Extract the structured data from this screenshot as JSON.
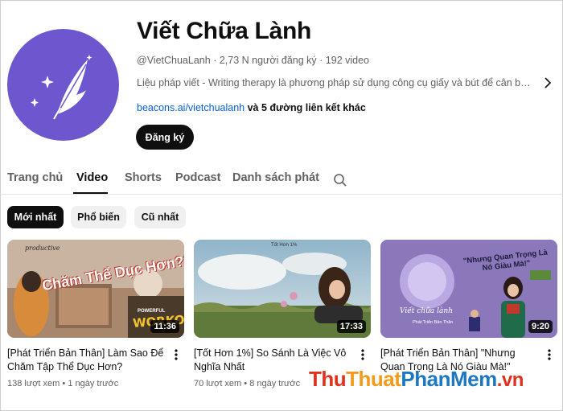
{
  "channel": {
    "title": "Viết Chữa Lành",
    "handle": "@VietChuaLanh",
    "subscribers": "2,73 N người đăng ký",
    "video_count": "192 video",
    "separator": "·",
    "description": "Liệu pháp viết - Writing therapy là phương pháp sử dụng công cụ giấy và bút để cân bằng c...",
    "link_url_text": "beacons.ai/vietchualanh",
    "link_extra": "và 5 đường liên kết khác",
    "subscribe_label": "Đăng ký",
    "avatar_color": "#6e56cf"
  },
  "tabs": [
    {
      "label": "Trang chủ"
    },
    {
      "label": "Video"
    },
    {
      "label": "Shorts"
    },
    {
      "label": "Podcast"
    },
    {
      "label": "Danh sách phát"
    }
  ],
  "chips": [
    {
      "label": "Mới nhất"
    },
    {
      "label": "Phổ biến"
    },
    {
      "label": "Cũ nhất"
    }
  ],
  "videos": [
    {
      "title": "[Phát Triển Bản Thân] Làm Sao Để Chăm Tập Thể Dục Hơn?",
      "views": "138 lượt xem",
      "age": "1 ngày trước",
      "duration": "11:36",
      "thumb_text_main": "Chăm Thể Dục Hơn???",
      "thumb_text_small": "productive",
      "thumb_text_badge": "WORKOUT",
      "thumb_text_badge_small": "POWERFUL"
    },
    {
      "title": "[Tốt Hơn 1%] So Sánh Là Việc Vô Nghĩa Nhất",
      "views": "70 lượt xem",
      "age": "8 ngày trước",
      "duration": "17:33",
      "thumb_text_small": "Tốt Hơn 1%"
    },
    {
      "title": "[Phát Triển Bản Thân] \"Nhưng Quan Trọng Là Nó Giàu Mà!\"",
      "views": "",
      "age": "",
      "duration": "9:20",
      "thumb_text_main": "\"Nhưng Quan Trọng Là Nó Giàu Mà!\"",
      "thumb_text_script": "Viết chữa lành",
      "thumb_text_sub": "Phát Triển Bản Thân"
    }
  ],
  "stats_separator": "•",
  "watermark": {
    "part1": "Thu",
    "part2": "Thuat",
    "part3": "PhanMem",
    "part4": ".vn"
  }
}
